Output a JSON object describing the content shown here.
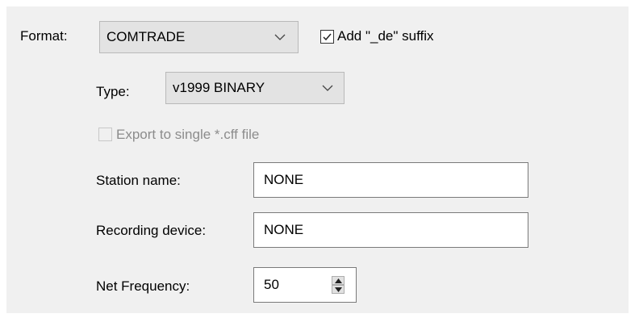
{
  "format": {
    "label": "Format:",
    "selected": "COMTRADE"
  },
  "suffix": {
    "label": "Add \"_de\" suffix",
    "checked": true
  },
  "type": {
    "label": "Type:",
    "selected": "v1999 BINARY"
  },
  "single_cff": {
    "label": "Export to single *.cff file",
    "checked": false,
    "enabled": false
  },
  "station_name": {
    "label": "Station name:",
    "value": "NONE"
  },
  "recording_device": {
    "label": "Recording device:",
    "value": "NONE"
  },
  "net_frequency": {
    "label": "Net Frequency:",
    "value": "50"
  },
  "icons": {
    "dropdown": "chevron-down-icon",
    "check": "checkmark-icon",
    "spin_up": "arrow-up-icon",
    "spin_down": "arrow-down-icon"
  },
  "colors": {
    "panel_bg": "#f0f0f0",
    "combo_bg": "#e3e3e3",
    "disabled_text": "#8c8c8c"
  }
}
